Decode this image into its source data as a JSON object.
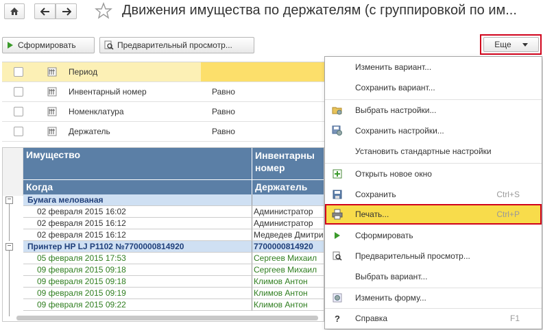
{
  "window": {
    "title": "Движения имущества по держателям (с группировкой по им..."
  },
  "toolbar": {
    "generate_label": "Сформировать",
    "preview_label": "Предварительный просмотр...",
    "more_label": "Еще"
  },
  "settings": {
    "rows": [
      {
        "label": "Период",
        "value": ""
      },
      {
        "label": "Инвентарный номер",
        "value": "Равно"
      },
      {
        "label": "Номенклатура",
        "value": "Равно"
      },
      {
        "label": "Держатель",
        "value": "Равно"
      }
    ]
  },
  "report": {
    "headers": {
      "col1_top": "Имущество",
      "col2_top_line1": "Инвентарны",
      "col2_top_line2": "номер",
      "col1_bottom": "Когда",
      "col2_bottom": "Держатель"
    },
    "groups": [
      {
        "name": "Бумага мелованая",
        "code": "",
        "rows": [
          {
            "when": "02 февраля 2015 16:02",
            "holder": "Администратор"
          },
          {
            "when": "02 февраля 2015 16:12",
            "holder": "Администратор"
          },
          {
            "when": "02 февраля 2015 16:12",
            "holder": "Медведев Дмитрий"
          }
        ]
      },
      {
        "name": "Принтер HP LJ P1102 №7700000814920",
        "code": "7700000814920",
        "rows": [
          {
            "when": "05 февраля 2015 17:53",
            "holder": "Сергеев Михаил"
          },
          {
            "when": "09 февраля 2015 09:18",
            "holder": "Сергеев Михаил"
          },
          {
            "when": "09 февраля 2015 09:18",
            "holder": "Климов Антон"
          },
          {
            "when": "09 февраля 2015 09:19",
            "holder": "Климов Антон"
          },
          {
            "when": "09 февраля 2015 09:22",
            "holder": "Климов Антон"
          }
        ]
      }
    ]
  },
  "menu": {
    "items": [
      {
        "label": "Изменить вариант...",
        "shortcut": "",
        "icon": ""
      },
      {
        "label": "Сохранить вариант...",
        "shortcut": "",
        "icon": ""
      },
      {
        "label": "Выбрать настройки...",
        "shortcut": "",
        "icon": "folder-gear-icon"
      },
      {
        "label": "Сохранить настройки...",
        "shortcut": "",
        "icon": "save-gear-icon"
      },
      {
        "label": "Установить стандартные настройки",
        "shortcut": "",
        "icon": ""
      },
      {
        "label": "Открыть новое окно",
        "shortcut": "",
        "icon": "new-window-icon"
      },
      {
        "label": "Сохранить",
        "shortcut": "Ctrl+S",
        "icon": "floppy-icon"
      },
      {
        "label": "Печать...",
        "shortcut": "Ctrl+P",
        "icon": "printer-icon"
      },
      {
        "label": "Сформировать",
        "shortcut": "",
        "icon": "play-icon"
      },
      {
        "label": "Предварительный просмотр...",
        "shortcut": "",
        "icon": "preview-icon"
      },
      {
        "label": "Выбрать вариант...",
        "shortcut": "",
        "icon": ""
      },
      {
        "label": "Изменить форму...",
        "shortcut": "",
        "icon": "form-gear-icon"
      },
      {
        "label": "Справка",
        "shortcut": "F1",
        "icon": "help-icon"
      }
    ],
    "help_glyph": "?"
  },
  "colors": {
    "header_blue": "#5b7fa6",
    "group_bg": "#cfe0f3",
    "group_text": "#1f3f7a",
    "green_text": "#2e7d1e",
    "highlight_red": "#d0021b",
    "print_highlight": "#f8dc4b",
    "period_row": "#fcf0b5"
  }
}
